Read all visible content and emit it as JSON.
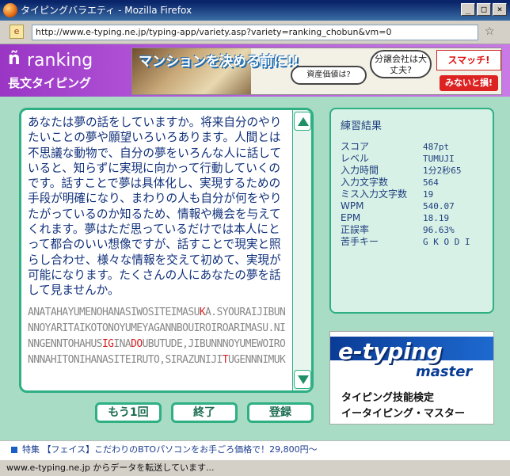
{
  "window": {
    "title": "タイピングバラエティ - Mozilla Firefox",
    "url": "http://www.e-typing.ne.jp/typing-app/variety.asp?variety=ranking_chobun&vm=0"
  },
  "header": {
    "app_name": "ranking",
    "mode_name": "長文タイピング"
  },
  "ad": {
    "lead": "マンションを決める前に!!",
    "bubble_value": "資産価値は?",
    "bubble_company": "分譲会社は大丈夫?",
    "brand": "スマッチ!",
    "cta": "みないと損!"
  },
  "passage": {
    "japanese": "あなたは夢の話をしていますか。将来自分のやりたいことの夢や願望いろいろあります。人間とは不思議な動物で、自分の夢をいろんな人に話していると、知らずに実現に向かって行動していくのです。話すことで夢は具体化し、実現するための手段が明確になり、まわりの人も自分が何をやりたがっているのか知るため、情報や機会を与えてくれます。夢はただ思っているだけでは本人にとって都合のいい想像ですが、話すことで現実と照らし合わせ、様々な情報を交えて初めて、実現が可能になります。たくさんの人にあなたの夢を話して見ませんか。",
    "romaji": [
      {
        "text": "ANATAHAYUMENOHANASIWOSITEIMASU",
        "hl": false
      },
      {
        "text": "K",
        "hl": true
      },
      {
        "text": "A.SYOURAIJIBUNNNOYARITAIKOTONOYUMEYAGANNBOUIROIROARIMASU.NINNGENNTOHAHUS",
        "hl": false
      },
      {
        "text": "IG",
        "hl": true
      },
      {
        "text": "INA",
        "hl": false
      },
      {
        "text": "DO",
        "hl": true
      },
      {
        "text": "UBUTUDE,JIBUNNNOYUMEWOIRONNNAHITONIHANASITEIRUTO,SIRAZUNIJI",
        "hl": false
      },
      {
        "text": "T",
        "hl": true
      },
      {
        "text": "UGENNNIMUK",
        "hl": false
      }
    ]
  },
  "buttons": {
    "retry": "もう1回",
    "finish": "終了",
    "register": "登録"
  },
  "results": {
    "title": "練習結果",
    "rows": [
      {
        "label": "スコア",
        "value": "487pt"
      },
      {
        "label": "レベル",
        "value": "TUMUJI"
      },
      {
        "label": "入力時間",
        "value": "1分2秒65"
      },
      {
        "label": "入力文字数",
        "value": "564"
      },
      {
        "label": "ミス入力文字数",
        "value": "19"
      },
      {
        "label": "WPM",
        "value": "540.07"
      },
      {
        "label": "EPM",
        "value": "18.19"
      },
      {
        "label": "正誤率",
        "value": "96.63%"
      },
      {
        "label": "苦手キー",
        "value": "G K O D I"
      }
    ]
  },
  "logo": {
    "brand": "e-typing",
    "sub": "master",
    "caption1": "タイピング技能検定",
    "caption2": "イータイピング・マスター"
  },
  "footer": {
    "text": "特集 【フェイス】こだわりのBTOパソコンをお手ごろ価格で！29,800円〜"
  },
  "status": {
    "text": "www.e-typing.ne.jp からデータを転送しています..."
  },
  "colors": {
    "accent": "#2eaf84",
    "header": "#b255d8",
    "content_bg": "#a8dcc4",
    "text_blue": "#0f2f7a",
    "error_red": "#d62020"
  }
}
